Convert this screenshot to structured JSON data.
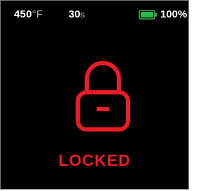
{
  "status_bar": {
    "temperature_value": "450",
    "temperature_unit": "°F",
    "timer_value": "30",
    "timer_unit": "s",
    "battery_percent": "100%",
    "battery_icon": "battery-full-icon",
    "battery_level": 1.0,
    "battery_color": "#2db84a"
  },
  "main": {
    "lock_icon": "padlock-locked-icon",
    "status_text": "LOCKED",
    "accent_color": "#ec1b24"
  },
  "screen": {
    "background_color": "#000000"
  }
}
